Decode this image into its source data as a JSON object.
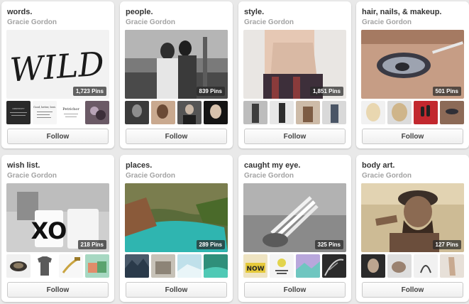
{
  "follow_label": "Follow",
  "boards": [
    {
      "title": "words.",
      "owner": "Gracie Gordon",
      "pins": "1,723 Pins",
      "cover_word": "WILD",
      "thumbs": [
        {
          "name": "quote-card-dark-thumb",
          "text": "CREATIVITY"
        },
        {
          "name": "quote-card-good-better-best-thumb",
          "text": "Good, better, best."
        },
        {
          "name": "quote-card-petrichor-thumb",
          "text": "Petrichor"
        },
        {
          "name": "jewelry-thumb",
          "text": ""
        }
      ]
    },
    {
      "title": "people.",
      "owner": "Gracie Gordon",
      "pins": "839 Pins",
      "cover_word": "",
      "thumbs": [
        {
          "name": "portrait-thumb-1",
          "text": ""
        },
        {
          "name": "portrait-thumb-2",
          "text": ""
        },
        {
          "name": "portrait-thumb-3",
          "text": ""
        },
        {
          "name": "portrait-thumb-4",
          "text": ""
        }
      ]
    },
    {
      "title": "style.",
      "owner": "Gracie Gordon",
      "pins": "1,851 Pins",
      "cover_word": "",
      "thumbs": [
        {
          "name": "outfit-thumb-1",
          "text": ""
        },
        {
          "name": "outfit-thumb-2",
          "text": ""
        },
        {
          "name": "outfit-thumb-3",
          "text": ""
        },
        {
          "name": "outfit-thumb-4",
          "text": ""
        }
      ]
    },
    {
      "title": "hair, nails, & makeup.",
      "owner": "Gracie Gordon",
      "pins": "501 Pins",
      "cover_word": "",
      "thumbs": [
        {
          "name": "hair-thumb-1",
          "text": ""
        },
        {
          "name": "hair-thumb-2",
          "text": ""
        },
        {
          "name": "nails-thumb",
          "text": ""
        },
        {
          "name": "makeup-thumb",
          "text": ""
        }
      ]
    },
    {
      "title": "wish list.",
      "owner": "Gracie Gordon",
      "pins": "218 Pins",
      "cover_word": "XO",
      "thumbs": [
        {
          "name": "camera-lens-thumb",
          "text": ""
        },
        {
          "name": "graphic-tee-thumb",
          "text": ""
        },
        {
          "name": "usb-cable-thumb",
          "text": ""
        },
        {
          "name": "pillows-thumb",
          "text": ""
        }
      ]
    },
    {
      "title": "places.",
      "owner": "Gracie Gordon",
      "pins": "289 Pins",
      "cover_word": "",
      "thumbs": [
        {
          "name": "mountain-lake-thumb",
          "text": ""
        },
        {
          "name": "ruins-thumb",
          "text": ""
        },
        {
          "name": "glacier-thumb",
          "text": ""
        },
        {
          "name": "lagoon-thumb",
          "text": ""
        }
      ]
    },
    {
      "title": "caught my eye.",
      "owner": "Gracie Gordon",
      "pins": "325 Pins",
      "cover_word": "",
      "thumbs": [
        {
          "name": "now-sign-thumb",
          "text": "NOW"
        },
        {
          "name": "poster-thumb",
          "text": ""
        },
        {
          "name": "pastel-landscape-thumb",
          "text": ""
        },
        {
          "name": "palm-leaf-thumb",
          "text": ""
        }
      ]
    },
    {
      "title": "body art.",
      "owner": "Gracie Gordon",
      "pins": "127 Pins",
      "cover_word": "",
      "thumbs": [
        {
          "name": "tattoo-thumb-1",
          "text": ""
        },
        {
          "name": "tattoo-thumb-2",
          "text": ""
        },
        {
          "name": "tattoo-thumb-3",
          "text": ""
        },
        {
          "name": "tattoo-thumb-4",
          "text": ""
        }
      ]
    }
  ]
}
